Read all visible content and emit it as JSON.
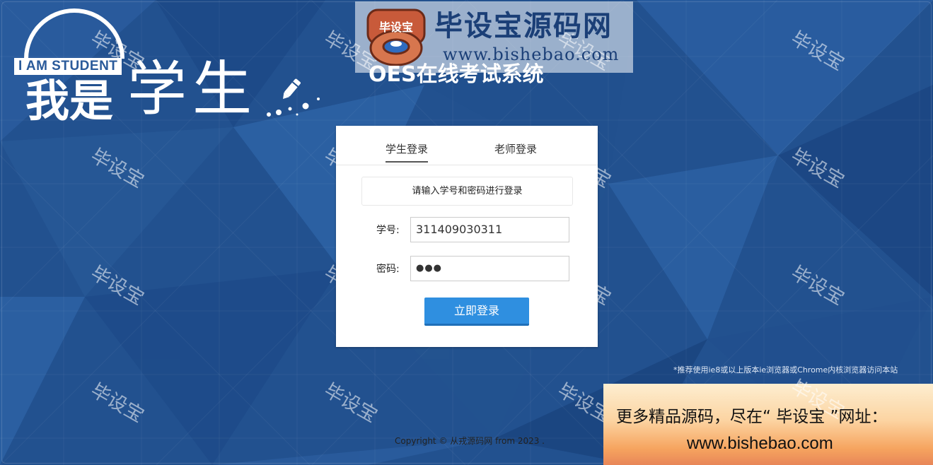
{
  "logo": {
    "iam_text": "I AM STUDENT",
    "woshi": "我是",
    "xuesheng": "学生"
  },
  "watermark_banner": {
    "mascot_text": "毕设宝",
    "title": "毕设宝源码网",
    "url": "www.bishebao.com"
  },
  "system_title": "OES在线考试系统",
  "watermark_text": "毕设宝",
  "login": {
    "tabs": [
      {
        "label": "学生登录",
        "active": true
      },
      {
        "label": "老师登录",
        "active": false
      }
    ],
    "hint": "请输入学号和密码进行登录",
    "id_label": "学号:",
    "id_value": "311409030311",
    "password_label": "密码:",
    "password_value": "●●●",
    "submit_label": "立即登录"
  },
  "browser_note": "*推荐使用ie8或以上版本ie浏览器或Chrome内核浏览器访问本站",
  "copyright": "Copyright © 从戎源码网 from 2023 .",
  "ad": {
    "line1": "更多精品源码，尽在“ 毕设宝 ”网址：",
    "line2": "www.bishebao.com"
  },
  "colors": {
    "background": "#1f4f8f",
    "button": "#2f8fe0",
    "ad_gradient_top": "#fdeed0",
    "ad_gradient_bottom": "#e88658"
  }
}
